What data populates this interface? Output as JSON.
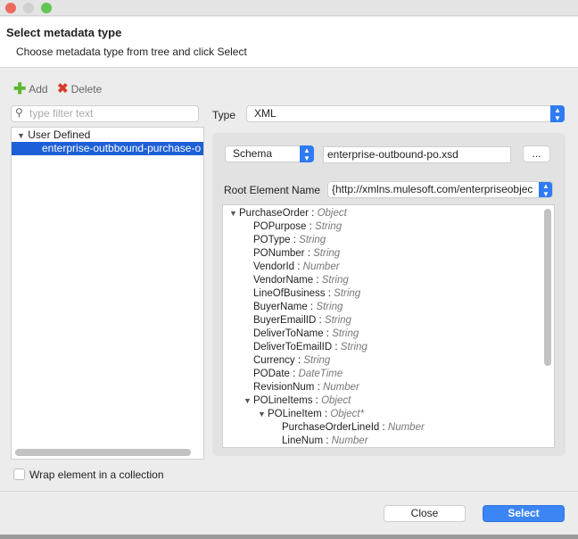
{
  "window": {
    "title": "Select metadata type",
    "subtitle": "Choose metadata type from tree and click Select"
  },
  "toolbar": {
    "add_label": "Add",
    "delete_label": "Delete"
  },
  "filter": {
    "placeholder": "type filter text"
  },
  "left_tree": {
    "group": "User Defined",
    "items": [
      "enterprise-outbbound-purchase-o"
    ]
  },
  "type": {
    "label": "Type",
    "value": "XML"
  },
  "schema": {
    "mode": "Schema",
    "file": "enterprise-outbound-po.xsd",
    "browse_label": "..."
  },
  "root_element": {
    "label": "Root Element Name",
    "value": "{http://xmlns.mulesoft.com/enterpriseobjec"
  },
  "schema_tree": [
    {
      "name": "PurchaseOrder",
      "type": "Object",
      "level": 0,
      "expanded": true
    },
    {
      "name": "POPurpose",
      "type": "String",
      "level": 1
    },
    {
      "name": "POType",
      "type": "String",
      "level": 1
    },
    {
      "name": "PONumber",
      "type": "String",
      "level": 1
    },
    {
      "name": "VendorId",
      "type": "Number",
      "level": 1
    },
    {
      "name": "VendorName",
      "type": "String",
      "level": 1
    },
    {
      "name": "LineOfBusiness",
      "type": "String",
      "level": 1
    },
    {
      "name": "BuyerName",
      "type": "String",
      "level": 1
    },
    {
      "name": "BuyerEmailID",
      "type": "String",
      "level": 1
    },
    {
      "name": "DeliverToName",
      "type": "String",
      "level": 1
    },
    {
      "name": "DeliverToEmailID",
      "type": "String",
      "level": 1
    },
    {
      "name": "Currency",
      "type": "String",
      "level": 1
    },
    {
      "name": "PODate",
      "type": "DateTime",
      "level": 1
    },
    {
      "name": "RevisionNum",
      "type": "Number",
      "level": 1
    },
    {
      "name": "POLineItems",
      "type": "Object",
      "level": 1,
      "expanded": true
    },
    {
      "name": "POLineItem",
      "type": "Object*",
      "level": 2,
      "expanded": true
    },
    {
      "name": "PurchaseOrderLineId",
      "type": "Number",
      "level": 3
    },
    {
      "name": "LineNum",
      "type": "Number",
      "level": 3
    }
  ],
  "wrap": {
    "label": "Wrap element in a collection",
    "checked": false
  },
  "buttons": {
    "close": "Close",
    "select": "Select"
  },
  "colors": {
    "accent": "#2f7bf5",
    "selection": "#1d5fd6"
  }
}
